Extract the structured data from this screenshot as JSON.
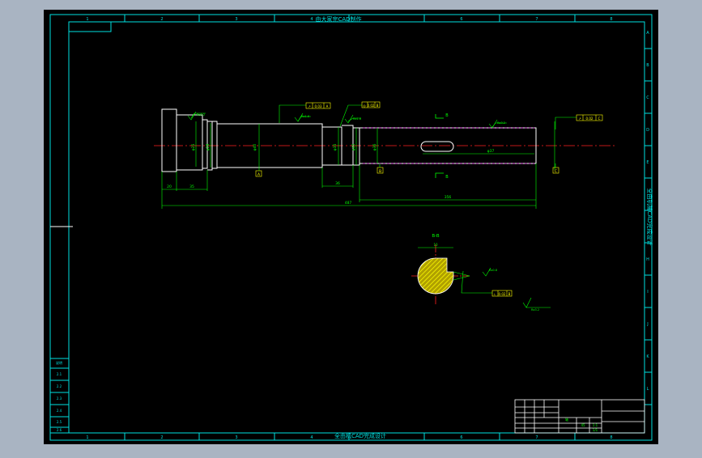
{
  "drawing": {
    "header_title": "由大家完CAD制作",
    "footer_title": "全由机CAD完成设计",
    "side_title": "全由机械CAD完成设计",
    "grid_numbers_top": [
      "1",
      "2",
      "3",
      "4",
      "5",
      "6",
      "7",
      "8"
    ],
    "grid_numbers_bottom": [
      "1",
      "2",
      "3",
      "4",
      "5",
      "6",
      "7",
      "8"
    ],
    "grid_letters_right": [
      "A",
      "B",
      "C",
      "D",
      "E",
      "F",
      "G",
      "H",
      "I",
      "J",
      "K",
      "L",
      "M"
    ],
    "section_label_top": "B",
    "section_label_bottom": "B",
    "section_view_title": "B-B",
    "datum_labels": [
      "A",
      "B",
      "C"
    ],
    "dimensions": {
      "d1": "φ25",
      "d2": "φ28",
      "d3": "φ40",
      "d4": "φ35",
      "d5": "φ45",
      "d6": "φ36",
      "length_1": "20",
      "length_2": "35",
      "length_3": "36",
      "length_4": "356",
      "total_length": "487",
      "slot": "φ37",
      "key_width": "10"
    },
    "gdt_frames": [
      {
        "symbol": "↗",
        "tol": "0.03",
        "datum": "A"
      },
      {
        "symbol": "◎",
        "tol": "0.02",
        "datum": "B"
      },
      {
        "symbol": "↗",
        "tol": "0.02",
        "datum": "C"
      },
      {
        "symbol": "⊥",
        "tol": "0.02",
        "datum": "B"
      }
    ],
    "roughness": [
      "Ra3.2",
      "Ra1.6",
      "Ra1.6",
      "Ra3.2",
      "Ra0.8",
      "Ra3.2"
    ],
    "left_table": [
      "说明",
      "2.1",
      "2.2",
      "2.3",
      "2.4",
      "2.5",
      "2.6"
    ],
    "title_block": {
      "part": "轴",
      "material": "45",
      "scale": "1:1",
      "sheet": "1/1"
    },
    "colors": {
      "background": "#000000",
      "frame": "#00e0e0",
      "dimension": "#00ff00",
      "part_outline": "#ffffff",
      "centerline": "#ff2020",
      "hatch": "#ffff00",
      "hidden_line": "#ff44ff",
      "outer_bg": "#a9b4c2"
    }
  }
}
